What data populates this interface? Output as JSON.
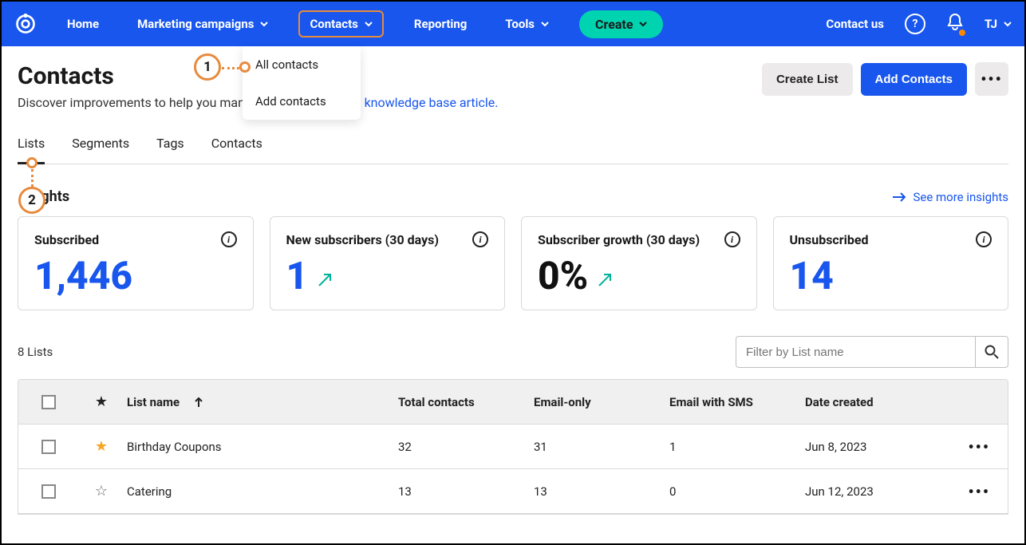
{
  "nav": {
    "home": "Home",
    "marketing": "Marketing campaigns",
    "contacts": "Contacts",
    "reporting": "Reporting",
    "tools": "Tools",
    "create": "Create",
    "contact_us": "Contact us",
    "user": "TJ"
  },
  "dropdown": {
    "all_contacts": "All contacts",
    "add_contacts": "Add contacts"
  },
  "page": {
    "title": "Contacts",
    "subtitle_prefix": "Discover improvements to help you manag",
    "subtitle_link": "knowledge base article.",
    "create_list": "Create List",
    "add_contacts": "Add Contacts"
  },
  "tabs": {
    "lists": "Lists",
    "segments": "Segments",
    "tags": "Tags",
    "contacts": "Contacts"
  },
  "insights": {
    "heading": "Insights",
    "see_more": "See more insights",
    "cards": [
      {
        "label": "Subscribed",
        "value": "1,446",
        "color": "blue",
        "trend": false
      },
      {
        "label": "New subscribers (30 days)",
        "value": "1",
        "color": "blue",
        "trend": true
      },
      {
        "label": "Subscriber growth (30 days)",
        "value": "0%",
        "color": "black",
        "trend": true
      },
      {
        "label": "Unsubscribed",
        "value": "14",
        "color": "blue",
        "trend": false
      }
    ]
  },
  "lists": {
    "count": "8 Lists",
    "filter_placeholder": "Filter by List name",
    "columns": {
      "name": "List name",
      "total": "Total contacts",
      "email": "Email-only",
      "sms": "Email with SMS",
      "date": "Date created"
    },
    "rows": [
      {
        "starred": true,
        "name": "Birthday Coupons",
        "total": "32",
        "email": "31",
        "sms": "1",
        "date": "Jun 8, 2023"
      },
      {
        "starred": false,
        "name": "Catering",
        "total": "13",
        "email": "13",
        "sms": "0",
        "date": "Jun 12, 2023"
      }
    ]
  },
  "annotations": {
    "step1": "1",
    "step2": "2"
  }
}
